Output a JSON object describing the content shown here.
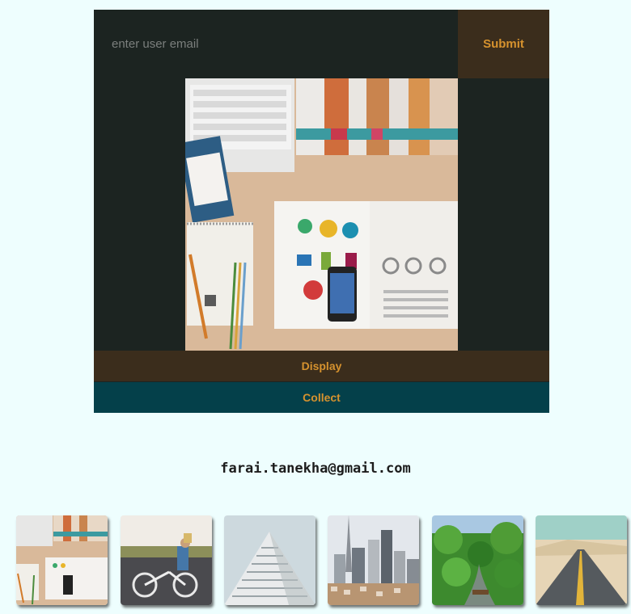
{
  "form": {
    "email_placeholder": "enter user email",
    "email_value": "",
    "submit_label": "Submit"
  },
  "actions": {
    "display_label": "Display",
    "collect_label": "Collect"
  },
  "user_email": "farai.tanekha@gmail.com",
  "colors": {
    "page_bg": "#eefefe",
    "panel_bg": "#1c2421",
    "brown_button": "#3b2d1c",
    "teal_button": "#04404a",
    "button_text": "#d6922e"
  },
  "gallery": [
    {
      "name": "thumb-desk"
    },
    {
      "name": "thumb-bicycle"
    },
    {
      "name": "thumb-building"
    },
    {
      "name": "thumb-city"
    },
    {
      "name": "thumb-forest"
    },
    {
      "name": "thumb-desert-road"
    }
  ]
}
